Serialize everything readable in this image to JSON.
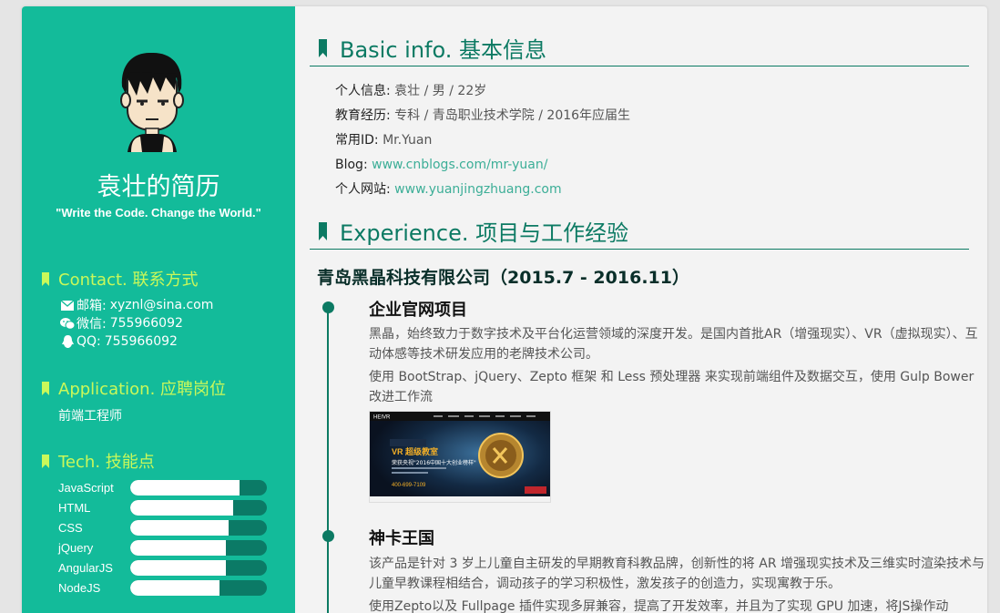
{
  "sidebar": {
    "name": "袁壮的简历",
    "motto": "\"Write the Code. Change the World.\"",
    "contact": {
      "title": "Contact. 联系方式",
      "items": [
        {
          "icon": "mail-icon",
          "label": "邮箱:",
          "value": "xyznl@sina.com"
        },
        {
          "icon": "wechat-icon",
          "label": "微信:",
          "value": "755966092"
        },
        {
          "icon": "qq-icon",
          "label": "QQ:",
          "value": "755966092"
        }
      ]
    },
    "application": {
      "title": "Application. 应聘岗位",
      "job": "前端工程师"
    },
    "tech": {
      "title": "Tech. 技能点",
      "skills": [
        {
          "name": "JavaScript",
          "level": 0.8
        },
        {
          "name": "HTML",
          "level": 0.75
        },
        {
          "name": "CSS",
          "level": 0.72
        },
        {
          "name": "jQuery",
          "level": 0.7
        },
        {
          "name": "AngularJS",
          "level": 0.7
        },
        {
          "name": "NodeJS",
          "level": 0.65
        }
      ]
    }
  },
  "main": {
    "basic": {
      "title": "Basic info. 基本信息",
      "rows": [
        {
          "label": "个人信息:",
          "value": "袁壮 / 男 / 22岁"
        },
        {
          "label": "教育经历:",
          "value": "专科 / 青岛职业技术学院 / 2016年应届生"
        },
        {
          "label": "常用ID:",
          "value": "Mr.Yuan"
        },
        {
          "label": "Blog:",
          "value": "www.cnblogs.com/mr-yuan/"
        },
        {
          "label": "个人网站:",
          "value": "www.yuanjingzhuang.com"
        }
      ]
    },
    "experience": {
      "title": "Experience. 项目与工作经验",
      "company": "青岛黑晶科技有限公司（2015.7 - 2016.11）",
      "projects": [
        {
          "title": "企业官网项目",
          "desc1": "黑晶，始终致力于数字技术及平台化运营领域的深度开发。是国内首批AR（增强现实）、VR（虚拟现实）、互动体感等技术研发应用的老牌技术公司。",
          "desc2": "使用 BootStrap、jQuery、Zepto 框架 和 Less 预处理器 来实现前端组件及数据交互，使用 Gulp Bower 改进工作流",
          "screenshot": {
            "brand": "HEIVR",
            "headline_tag": "VR 超级教室",
            "headline": "荣获央视\"2016中国十大创业榜样\"",
            "phone": "400-699-7109"
          }
        },
        {
          "title": "神卡王国",
          "desc1": "该产品是针对 3 岁上儿童自主研发的早期教育科教品牌，创新性的将 AR 增强现实技术及三维实时渲染技术与儿童早教课程相结合，调动孩子的学习积极性，激发孩子的创造力，实现寓教于乐。",
          "desc2": "使用Zepto以及 Fullpage 插件实现多屏兼容，提高了开发效率，并且为了实现 GPU 加速，将JS操作动"
        }
      ]
    }
  },
  "colors": {
    "sidebar_bg": "#13bb9a",
    "accent_dark": "#0c7a63",
    "sidebar_heading": "#c9f85a",
    "link": "#3cae97"
  }
}
